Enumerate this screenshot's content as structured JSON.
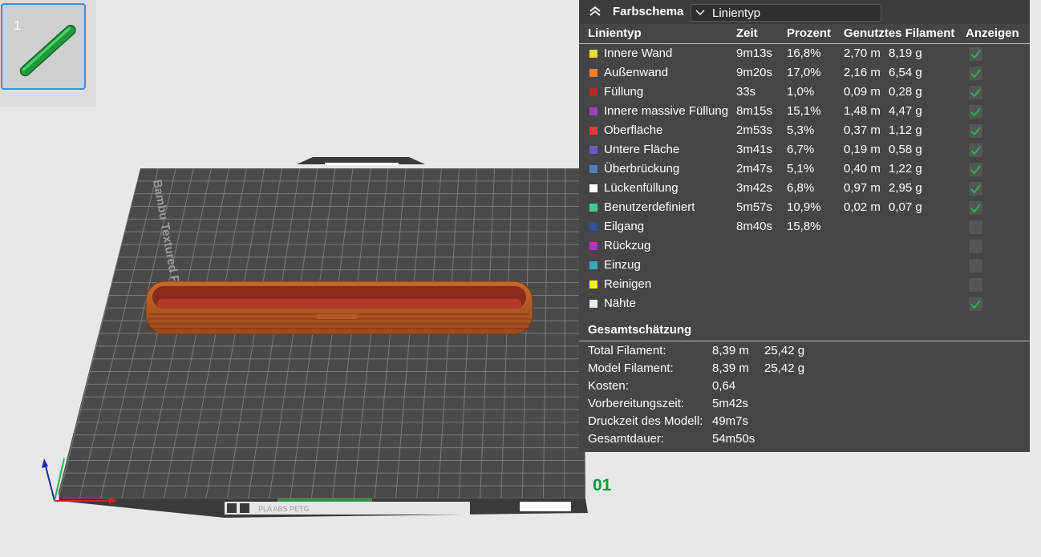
{
  "plate_thumbnail": {
    "number": "1"
  },
  "plate_label": "01",
  "bed": {
    "brand_text": "Bambu Textured PEI Plate",
    "filament_types": "PLA ABS PETG"
  },
  "legend": {
    "title": "Farbschema",
    "view_type": "Linientyp",
    "columns": [
      "Linientyp",
      "Zeit",
      "Prozent",
      "Genutztes Filament",
      "Anzeigen"
    ],
    "rows": [
      {
        "name": "Innere Wand",
        "color": "#f2d83c",
        "time": "9m13s",
        "percent": "16,8%",
        "length": "2,70 m",
        "weight": "8,19 g",
        "show": true
      },
      {
        "name": "Außenwand",
        "color": "#f07a32",
        "time": "9m20s",
        "percent": "17,0%",
        "length": "2,16 m",
        "weight": "6,54 g",
        "show": true
      },
      {
        "name": "Füllung",
        "color": "#b02a2a",
        "time": "33s",
        "percent": "1,0%",
        "length": "0,09 m",
        "weight": "0,28 g",
        "show": true
      },
      {
        "name": "Innere massive Füllung",
        "color": "#9b3fbf",
        "time": "8m15s",
        "percent": "15,1%",
        "length": "1,48 m",
        "weight": "4,47 g",
        "show": true
      },
      {
        "name": "Oberfläche",
        "color": "#e23a3a",
        "time": "2m53s",
        "percent": "5,3%",
        "length": "0,37 m",
        "weight": "1,12 g",
        "show": true
      },
      {
        "name": "Untere Fläche",
        "color": "#6b5bc9",
        "time": "3m41s",
        "percent": "6,7%",
        "length": "0,19 m",
        "weight": "0,58 g",
        "show": true
      },
      {
        "name": "Überbrückung",
        "color": "#4a7fc0",
        "time": "2m47s",
        "percent": "5,1%",
        "length": "0,40 m",
        "weight": "1,22 g",
        "show": true
      },
      {
        "name": "Lückenfüllung",
        "color": "#ffffff",
        "time": "3m42s",
        "percent": "6,8%",
        "length": "0,97 m",
        "weight": "2,95 g",
        "show": true
      },
      {
        "name": "Benutzerdefiniert",
        "color": "#3fcc8a",
        "time": "5m57s",
        "percent": "10,9%",
        "length": "0,02 m",
        "weight": "0,07 g",
        "show": true
      },
      {
        "name": "Eilgang",
        "color": "#2f4f9f",
        "time": "8m40s",
        "percent": "15,8%",
        "length": "",
        "weight": "",
        "show": false
      },
      {
        "name": "Rückzug",
        "color": "#c42ac4",
        "time": "",
        "percent": "",
        "length": "",
        "weight": "",
        "show": false
      },
      {
        "name": "Einzug",
        "color": "#3aa7c9",
        "time": "",
        "percent": "",
        "length": "",
        "weight": "",
        "show": false
      },
      {
        "name": "Reinigen",
        "color": "#f5f500",
        "time": "",
        "percent": "",
        "length": "",
        "weight": "",
        "show": false
      },
      {
        "name": "Nähte",
        "color": "#e9e9e9",
        "time": "",
        "percent": "",
        "length": "",
        "weight": "",
        "show": true
      }
    ],
    "summary_title": "Gesamtschätzung",
    "summary": [
      {
        "label": "Total Filament:",
        "value": "8,39 m",
        "value2": "25,42 g"
      },
      {
        "label": "Model Filament:",
        "value": "8,39 m",
        "value2": "25,42 g"
      },
      {
        "label": "Kosten:",
        "value": "0,64",
        "value2": ""
      },
      {
        "label": "Vorbereitungszeit:",
        "value": "5m42s",
        "value2": ""
      },
      {
        "label": "Druckzeit des Modell:",
        "value": "49m7s",
        "value2": ""
      },
      {
        "label": "Gesamtdauer:",
        "value": "54m50s",
        "value2": ""
      }
    ]
  }
}
